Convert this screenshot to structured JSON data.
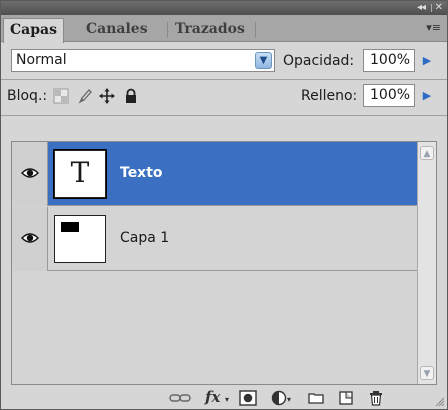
{
  "tabs": [
    {
      "label": "Capas"
    },
    {
      "label": "Canales"
    },
    {
      "label": "Trazados"
    }
  ],
  "blend_mode": "Normal",
  "opacity": {
    "label": "Opacidad:",
    "value": "100%"
  },
  "lock": {
    "label": "Bloq.:"
  },
  "fill": {
    "label": "Relleno:",
    "value": "100%"
  },
  "layers": [
    {
      "name": "Texto",
      "visible": true,
      "selected": true,
      "type": "text",
      "thumb_glyph": "T"
    },
    {
      "name": "Capa 1",
      "visible": true,
      "selected": false,
      "type": "pixel"
    }
  ],
  "colors": {
    "selection": "#3a6fc2",
    "panel": "#d6d6d6",
    "accent": "#2e6bc5"
  },
  "bottom_icons": [
    "link-layers-icon",
    "fx-icon",
    "add-mask-icon",
    "adjustment-layer-icon",
    "new-group-icon",
    "new-layer-icon",
    "trash-icon"
  ],
  "fx_label": "fx"
}
